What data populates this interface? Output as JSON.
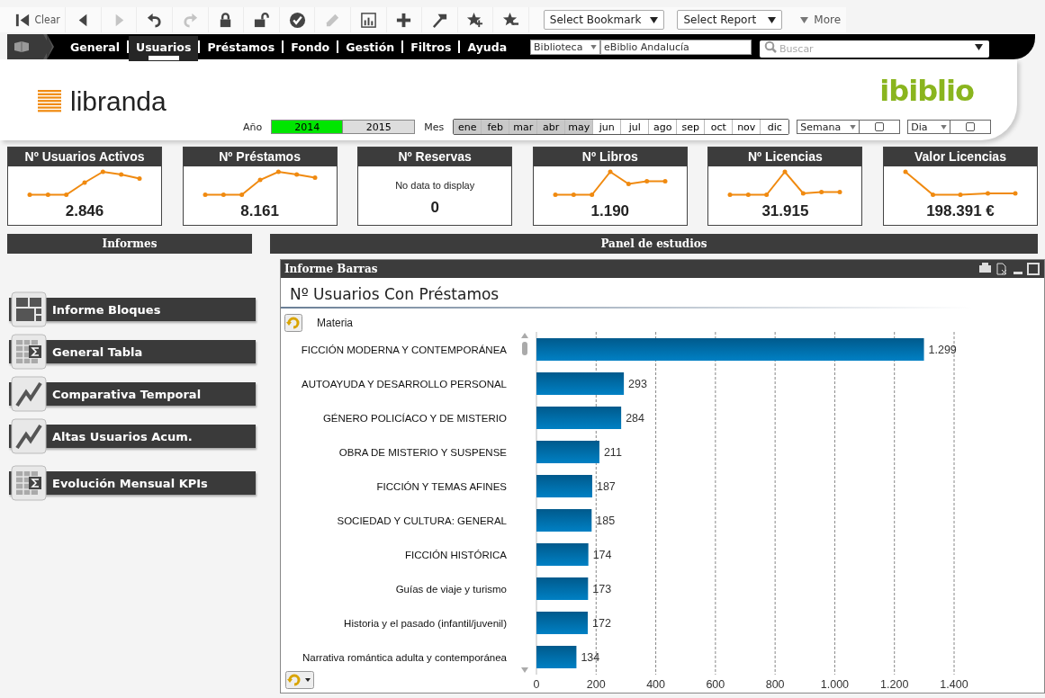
{
  "toolbar": {
    "buttons": [
      {
        "kind": "clear",
        "label": "Clear",
        "disabled": false
      },
      {
        "kind": "back",
        "disabled": false
      },
      {
        "kind": "forward",
        "disabled": true
      },
      {
        "kind": "undo",
        "disabled": false
      },
      {
        "kind": "redo",
        "disabled": true
      },
      {
        "kind": "lock",
        "disabled": false
      },
      {
        "kind": "unlock",
        "disabled": false
      },
      {
        "kind": "check",
        "disabled": false
      },
      {
        "kind": "edit",
        "disabled": true
      },
      {
        "kind": "report",
        "disabled": false
      },
      {
        "kind": "add",
        "disabled": false
      },
      {
        "kind": "pin",
        "disabled": false
      },
      {
        "kind": "star_add",
        "disabled": false
      },
      {
        "kind": "star_remove",
        "disabled": false
      }
    ],
    "bookmark_select": "Select Bookmark",
    "report_select": "Select Report",
    "more": "More"
  },
  "nav": {
    "tabs": [
      {
        "label": "General",
        "selected": false
      },
      {
        "label": "Usuarios",
        "selected": true
      },
      {
        "label": "Préstamos",
        "selected": false
      },
      {
        "label": "Fondo",
        "selected": false
      },
      {
        "label": "Gestión",
        "selected": false
      },
      {
        "label": "Filtros",
        "selected": false
      },
      {
        "label": "Ayuda",
        "selected": false
      }
    ],
    "library_select": "Biblioteca",
    "library_value": "eBiblio Andalucía",
    "search": {
      "placeholder": "Buscar"
    }
  },
  "header": {
    "logo": "libranda",
    "brand": "ibiblio",
    "year_label": "Año",
    "years": [
      {
        "label": "2014",
        "selected": true
      },
      {
        "label": "2015",
        "selected": false
      }
    ],
    "month_label": "Mes",
    "months": [
      {
        "label": "ene",
        "excluded": true
      },
      {
        "label": "feb",
        "excluded": true
      },
      {
        "label": "mar",
        "excluded": true
      },
      {
        "label": "abr",
        "excluded": true
      },
      {
        "label": "may",
        "excluded": true
      },
      {
        "label": "jun",
        "excluded": false
      },
      {
        "label": "jul",
        "excluded": false
      },
      {
        "label": "ago",
        "excluded": false
      },
      {
        "label": "sep",
        "excluded": false
      },
      {
        "label": "oct",
        "excluded": false
      },
      {
        "label": "nov",
        "excluded": false
      },
      {
        "label": "dic",
        "excluded": false
      }
    ],
    "week_select": "Semana",
    "week_checkbox": {
      "checked": false
    },
    "day_select": "Dia",
    "day_checkbox": {
      "checked": false
    }
  },
  "kpis": [
    {
      "title": "Nº Usuarios Activos",
      "kind": "sparkline",
      "value": "2.846"
    },
    {
      "title": "Nº Préstamos",
      "kind": "sparkline",
      "value": "8.161"
    },
    {
      "title": "Nº Reservas",
      "kind": "no_data",
      "message": "No data to display",
      "value": "0"
    },
    {
      "title": "Nº Libros",
      "kind": "sparkline",
      "value": "1.190"
    },
    {
      "title": "Nº Licencias",
      "kind": "sparkline",
      "value": "31.915"
    },
    {
      "title": "Valor Licencias",
      "kind": "sparkline",
      "value": "198.391 €"
    }
  ],
  "informes": {
    "title": "Informes",
    "items": [
      {
        "label": "Informe Bloques",
        "kind": "blocks"
      },
      {
        "label": "General Tabla",
        "kind": "table"
      },
      {
        "label": "Comparativa Temporal",
        "kind": "line"
      },
      {
        "label": "Altas Usuarios Acum.",
        "kind": "line"
      },
      {
        "label": "Evolución Mensual KPIs",
        "kind": "table"
      }
    ]
  },
  "panel": {
    "title": "Panel de estudios",
    "window": {
      "caption": "Informe Barras",
      "title": "Nº Usuarios Con Préstamos",
      "dimension": "Materia",
      "chart_data": {
        "type": "bar",
        "orientation": "horizontal",
        "grid": true,
        "categories": [
          "FICCIÓN MODERNA Y CONTEMPORÁNEA",
          "AUTOAYUDA Y DESARROLLO PERSONAL",
          "GÉNERO POLICÍACO Y DE MISTERIO",
          "OBRA DE MISTERIO Y SUSPENSE",
          "FICCIÓN Y TEMAS AFINES",
          "SOCIEDAD Y CULTURA: GENERAL",
          "FICCIÓN HISTÓRICA",
          "Guías de viaje y turismo",
          "Historia y el pasado (infantil/juvenil)",
          "Narrativa romántica adulta y contemporánea"
        ],
        "values": [
          1299,
          293,
          284,
          211,
          187,
          185,
          174,
          173,
          172,
          134
        ],
        "value_labels": [
          "1.299",
          "293",
          "284",
          "211",
          "187",
          "185",
          "174",
          "173",
          "172",
          "134"
        ],
        "xlim": [
          0,
          1400
        ],
        "xticks": [
          {
            "value": 0,
            "label": "0"
          },
          {
            "value": 200,
            "label": "200"
          },
          {
            "value": 400,
            "label": "400"
          },
          {
            "value": 600,
            "label": "600"
          },
          {
            "value": 800,
            "label": "800"
          },
          {
            "value": 1000,
            "label": "1.000"
          },
          {
            "value": 1200,
            "label": "1.200"
          },
          {
            "value": 1400,
            "label": "1.400"
          }
        ]
      }
    }
  }
}
